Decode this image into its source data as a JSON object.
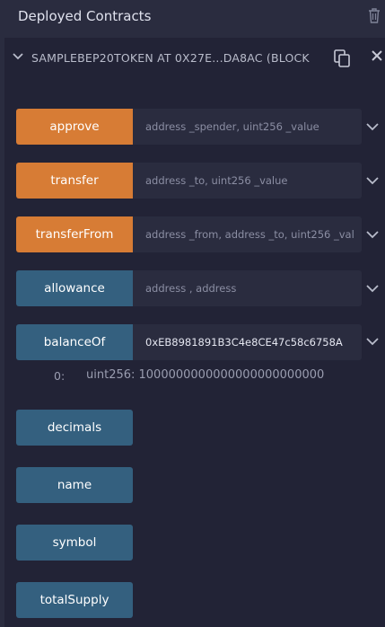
{
  "header": {
    "title": "Deployed Contracts"
  },
  "contract": {
    "title": "SAMPLEBEP20TOKEN AT 0X27E...DA8AC (BLOCK"
  },
  "functions": [
    {
      "name": "approve",
      "style": "orange",
      "placeholder": "address _spender, uint256 _value",
      "value": ""
    },
    {
      "name": "transfer",
      "style": "orange",
      "placeholder": "address _to, uint256 _value",
      "value": ""
    },
    {
      "name": "transferFrom",
      "style": "orange",
      "placeholder": "address _from, address _to, uint256 _val",
      "value": ""
    },
    {
      "name": "allowance",
      "style": "blue",
      "placeholder": "address , address",
      "value": ""
    },
    {
      "name": "balanceOf",
      "style": "blue",
      "placeholder": "",
      "value": "0xEB8981891B3C4e8CE47c58c6758A"
    },
    {
      "name": "decimals",
      "style": "blue"
    },
    {
      "name": "name",
      "style": "blue"
    },
    {
      "name": "symbol",
      "style": "blue"
    },
    {
      "name": "totalSupply",
      "style": "blue"
    }
  ],
  "result": {
    "index": "0:",
    "value": "uint256: 1000000000000000000000000"
  },
  "icons": [
    "trash-icon",
    "chevron-down-icon",
    "copy-icon",
    "close-icon"
  ],
  "colors": {
    "transact": "#d77c35",
    "call": "#34607f",
    "background": "#2a2c3f",
    "panel": "#222336"
  }
}
